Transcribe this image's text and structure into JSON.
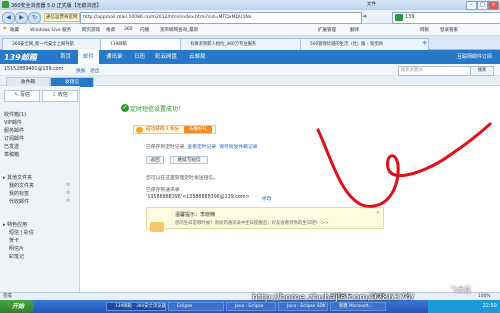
{
  "browser": {
    "title": "360安全浏览器 5.0 正式版【无痕浏览】",
    "window_controls": [
      "–",
      "□",
      "×"
    ],
    "nav": {
      "back": "◀",
      "forward": "▶",
      "refresh": "↻"
    },
    "site_tag": "通信运营商官网",
    "url": "http://appmail.mail.10086.cn/m2012/html/index.html?sid=MTQxMDU1Nx",
    "search_value": "139",
    "right_links": [
      "文件",
      "查看",
      "收藏",
      "工具",
      "帮助"
    ],
    "favorites": [
      {
        "label": "收藏"
      },
      {
        "label": "Windows Live 服务"
      },
      {
        "label": "网页游戏"
      },
      {
        "label": "格调"
      },
      {
        "label": "360"
      },
      {
        "label": "闪播"
      },
      {
        "label": "宽带联网查询_最新"
      }
    ],
    "fav_right": [
      "扩展管理",
      "翻译",
      "网银",
      "登录管家"
    ],
    "tabs": [
      {
        "label": "360安全网_新一代安全上网导航",
        "active": false
      },
      {
        "label": "139邮箱",
        "active": true
      },
      {
        "label": "有缘求到新人相约_360万专业服务",
        "active": false
      },
      {
        "label": "500管理优越的生活（社）服 - 淘宝网",
        "active": false
      }
    ]
  },
  "mail": {
    "logo": "139邮箱",
    "nav_tabs": [
      "首页",
      "邮件",
      "通讯录",
      "日历",
      "彩云网盘",
      "云邮局"
    ],
    "active_nav": 1,
    "homepage_link": "互联网邮件订阅",
    "account": "15152889401@139.com",
    "account_links": [
      "换肤",
      "退出"
    ],
    "search_placeholder": "搜索关键词",
    "search_button": "搜索",
    "page_tabs": [
      "收件箱",
      "发短信"
    ],
    "active_page_tab": 1
  },
  "sidebar": {
    "write": "写信",
    "receive": "收信",
    "folders": [
      "收件箱(1)",
      "VIP邮件",
      "服务邮件",
      "订阅邮件",
      "已发送",
      "草稿箱"
    ],
    "other_section": "其他文件夹",
    "other_folders": [
      "我的文件夹",
      "我的标签",
      "代收邮件"
    ],
    "apps_section": "特色应用",
    "apps": [
      "短信 | 彩信",
      "贺卡",
      "明信片",
      "彩笔记"
    ]
  },
  "content": {
    "success_title": "定时短信设置成功！",
    "bonus_text": "成功获得 1 积分",
    "bonus_button": "去换好礼",
    "sent_record_text": "已保存到定时记录",
    "view_record_link": "查看定时记录",
    "save_record_link": "保存到发件箱记录",
    "button_return": "返回",
    "button_continue": "继续写短信",
    "tip_text": "您可以在这里管理定时发送短信。",
    "saved_contacts_label": "已保存到通讯录",
    "saved_contacts_value": "'13588888396'<13588888396@139.com>",
    "edit_link": "修改",
    "notice_title": "温馨提示：李晓楠",
    "notice_body": "您的生日是哪时候？添加到通讯录中生日提醒后，好友会看到你的生日吧！ >>",
    "notice_close": "×"
  },
  "statusbar": {
    "left": "完成",
    "items": [
      "浏览器医生",
      "加速器",
      "下载",
      "100%"
    ]
  },
  "taskbar": {
    "start": "开始",
    "tasks": [
      {
        "label": "139邮箱 - 360安全浏览器",
        "active": true
      },
      {
        "label": "Eclipse",
        "active": false
      },
      {
        "label": "Java - Eclipse",
        "active": false
      },
      {
        "label": "Java - Eclipse SDK",
        "active": false
      },
      {
        "label": "新建 Microsoft...",
        "active": false
      }
    ],
    "clock": "22:59"
  },
  "watermark": "http://home.zhubajie.com/9286374/",
  "watermark_name": "飞龙喜",
  "colors": {
    "accent": "#2878c8",
    "success": "#2f8d2f",
    "bonus_button": "#f28a20",
    "annotation": "#e0101a"
  }
}
